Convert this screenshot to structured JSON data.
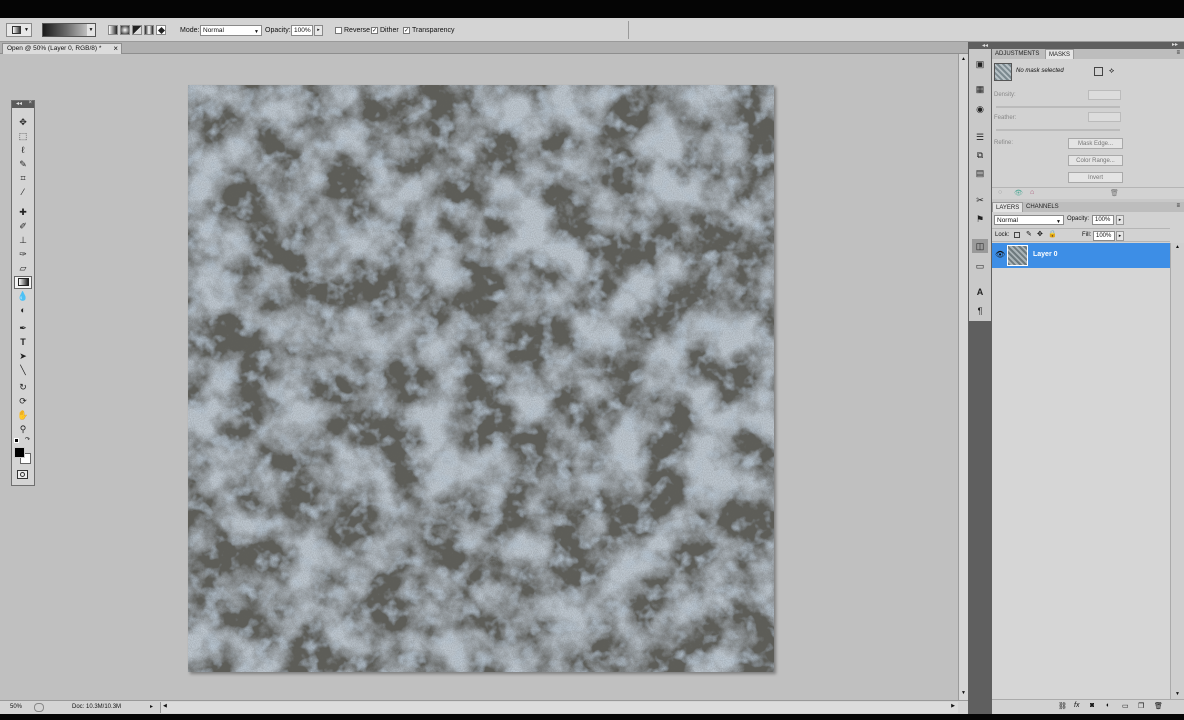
{
  "options_bar": {
    "mode_label": "Mode:",
    "mode_value": "Normal",
    "opacity_label": "Opacity:",
    "opacity_value": "100%",
    "reverse_label": "Reverse",
    "dither_label": "Dither",
    "transparency_label": "Transparency",
    "reverse_checked": false,
    "dither_checked": true,
    "transparency_checked": true
  },
  "document": {
    "tab_title": "Open @ 50% (Layer 0, RGB/8) *",
    "close_glyph": "×"
  },
  "status": {
    "zoom": "50%",
    "doc_info": "Doc: 10.3M/10.3M"
  },
  "tools": {
    "icons": [
      "move-tool-icon",
      "marquee-tool-icon",
      "lasso-tool-icon",
      "quick-select-tool-icon",
      "crop-tool-icon",
      "eyedropper-tool-icon",
      "healing-brush-tool-icon",
      "brush-tool-icon",
      "clone-stamp-tool-icon",
      "history-brush-tool-icon",
      "eraser-tool-icon",
      "gradient-tool-icon",
      "blur-tool-icon",
      "dodge-tool-icon",
      "pen-tool-icon",
      "type-tool-icon",
      "path-select-tool-icon",
      "line-tool-icon",
      "3d-rotate-tool-icon",
      "3d-orbit-tool-icon",
      "hand-tool-icon",
      "zoom-tool-icon"
    ],
    "active_index": 11
  },
  "masks_panel": {
    "tab_adjustments": "ADJUSTMENTS",
    "tab_masks": "MASKS",
    "no_mask": "No mask selected",
    "density_label": "Density:",
    "feather_label": "Feather:",
    "refine_label": "Refine:",
    "mask_edge_button": "Mask Edge...",
    "color_range_button": "Color Range...",
    "invert_button": "Invert"
  },
  "layers_panel": {
    "tab_layers": "LAYERS",
    "tab_channels": "CHANNELS",
    "blend_mode": "Normal",
    "opacity_label": "Opacity:",
    "opacity_value": "100%",
    "lock_label": "Lock:",
    "fill_label": "Fill:",
    "fill_value": "100%",
    "layers": [
      {
        "name": "Layer 0",
        "visible": true,
        "selected": true
      }
    ]
  },
  "colors": {
    "selection_blue": "#3d8ee6",
    "ui_gray": "#d4d4d4",
    "canvas_gray": "#c0c0c0"
  }
}
